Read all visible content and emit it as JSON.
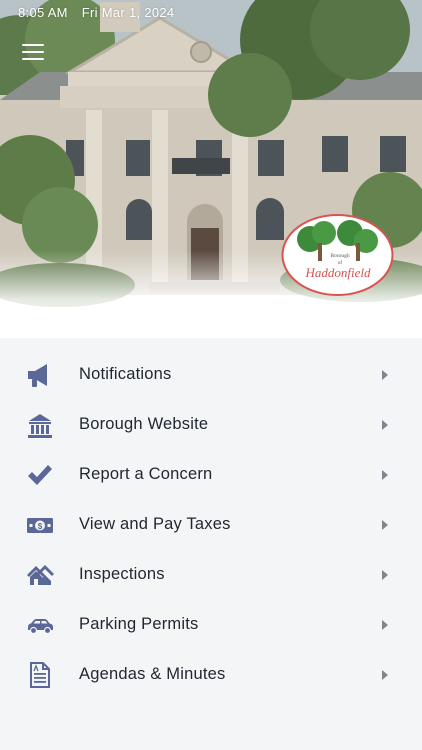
{
  "status_bar": {
    "time": "8:05 AM",
    "date": "Fri Mar 1, 2024"
  },
  "header": {
    "menu_icon": "hamburger-menu-icon"
  },
  "logo": {
    "line1": "Borough",
    "line2": "of",
    "line3": "Haddonfield"
  },
  "colors": {
    "icon": "#5a6797",
    "chevron": "#7f8591",
    "text": "#222831",
    "menu_bg": "#f4f5f7",
    "logo_red": "#d9534f"
  },
  "menu": {
    "items": [
      {
        "label": "Notifications",
        "icon": "megaphone-icon"
      },
      {
        "label": "Borough Website",
        "icon": "bank-building-icon"
      },
      {
        "label": "Report a Concern",
        "icon": "checkmark-icon"
      },
      {
        "label": "View and Pay Taxes",
        "icon": "money-bill-icon"
      },
      {
        "label": "Inspections",
        "icon": "houses-icon"
      },
      {
        "label": "Parking Permits",
        "icon": "car-icon"
      },
      {
        "label": "Agendas & Minutes",
        "icon": "document-icon"
      }
    ]
  }
}
